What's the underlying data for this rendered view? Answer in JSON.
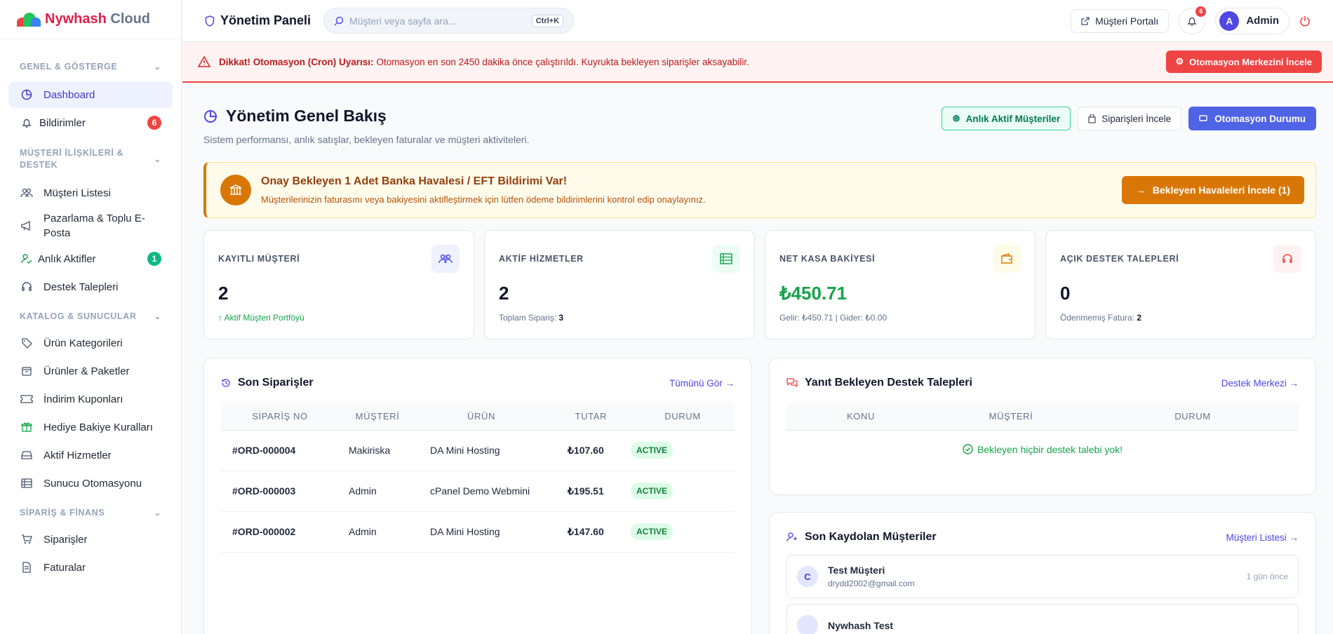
{
  "brand": {
    "name_part1": "Nywhash",
    "name_part2": "Cloud"
  },
  "sidebar": {
    "sections": [
      {
        "label": "GENEL & GÖSTERGE"
      },
      {
        "label": "MÜŞTERİ İLİŞKİLERİ & DESTEK"
      },
      {
        "label": "KATALOG & SUNUCULAR"
      },
      {
        "label": "SİPARİŞ & FİNANS"
      }
    ],
    "items": [
      {
        "label": "Dashboard"
      },
      {
        "label": "Bildirimler",
        "badge": "6"
      },
      {
        "label": "Müşteri Listesi"
      },
      {
        "label": "Pazarlama & Toplu E-Posta"
      },
      {
        "label": "Anlık Aktifler",
        "badge": "1"
      },
      {
        "label": "Destek Talepleri"
      },
      {
        "label": "Ürün Kategorileri"
      },
      {
        "label": "Ürünler & Paketler"
      },
      {
        "label": "İndirim Kuponları"
      },
      {
        "label": "Hediye Bakiye Kuralları"
      },
      {
        "label": "Aktif Hizmetler"
      },
      {
        "label": "Sunucu Otomasyonu"
      },
      {
        "label": "Siparişler"
      },
      {
        "label": "Faturalar"
      }
    ]
  },
  "topbar": {
    "title": "Yönetim Paneli",
    "search_placeholder": "Müşteri veya sayfa ara...",
    "search_shortcut": "Ctrl+K",
    "portal_label": "Müşteri Portalı",
    "notif_count": "6",
    "user_initial": "A",
    "user_name": "Admin"
  },
  "alert": {
    "title": "Dikkat! Otomasyon (Cron) Uyarısı:",
    "message": "Otomasyon en son 2450 dakika önce çalıştırıldı. Kuyrukta bekleyen siparişler aksayabilir.",
    "button": "Otomasyon Merkezini İncele"
  },
  "page": {
    "title": "Yönetim Genel Bakış",
    "subtitle": "Sistem performansı, anlık satışlar, bekleyen faturalar ve müşteri aktiviteleri.",
    "btn_active": "Anlık Aktif Müşteriler",
    "btn_orders": "Siparişleri İncele",
    "btn_automation": "Otomasyon Durumu"
  },
  "bank": {
    "title": "Onay Bekleyen 1 Adet Banka Havalesi / EFT Bildirimi Var!",
    "text": "Müşterilerinizin faturasını veya bakiyesini aktifleştirmek için lütfen ödeme bildirimlerini kontrol edip onaylayınız.",
    "button": "Bekleyen Havaleleri İncele (1)"
  },
  "stats": [
    {
      "label": "KAYITLI MÜŞTERİ",
      "value": "2",
      "sub": "Aktif Müşteri Portföyü"
    },
    {
      "label": "AKTİF HİZMETLER",
      "value": "2",
      "sub_prefix": "Toplam Sipariş:",
      "sub_value": "3"
    },
    {
      "label": "NET KASA BAKİYESİ",
      "value": "₺450.71",
      "sub": "Gelir: ₺450.71 | Gider: ₺0.00"
    },
    {
      "label": "AÇIK DESTEK TALEPLERİ",
      "value": "0",
      "sub_prefix": "Ödenmemiş Fatura:",
      "sub_value": "2"
    }
  ],
  "orders": {
    "title": "Son Siparişler",
    "link": "Tümünü Gör →",
    "headers": [
      "SİPARİŞ NO",
      "MÜŞTERİ",
      "ÜRÜN",
      "TUTAR",
      "DURUM"
    ],
    "rows": [
      {
        "no": "#ORD-000004",
        "customer": "Makiriska",
        "product": "DA Mini Hosting",
        "amount": "₺107.60",
        "status": "ACTIVE"
      },
      {
        "no": "#ORD-000003",
        "customer": "Admin",
        "product": "cPanel Demo Webmini",
        "amount": "₺195.51",
        "status": "ACTIVE"
      },
      {
        "no": "#ORD-000002",
        "customer": "Admin",
        "product": "DA Mini Hosting",
        "amount": "₺147.60",
        "status": "ACTIVE"
      }
    ]
  },
  "tickets": {
    "title": "Yanıt Bekleyen Destek Talepleri",
    "link": "Destek Merkezi →",
    "headers": [
      "KONU",
      "MÜŞTERİ",
      "DURUM"
    ],
    "empty": "Bekleyen hiçbir destek talebi yok!"
  },
  "customers": {
    "title": "Son Kaydolan Müşteriler",
    "link": "Müşteri Listesi →",
    "items": [
      {
        "initial": "C",
        "name": "Test Müşteri",
        "email": "drydd2002@gmail.com",
        "time": "1 gün önce"
      },
      {
        "initial": "",
        "name": "Nywhash Test",
        "email": "",
        "time": ""
      }
    ]
  },
  "colors": {
    "accent": "#4f46e5",
    "danger": "#ef4444",
    "success": "#16a34a",
    "warning": "#d97706"
  }
}
